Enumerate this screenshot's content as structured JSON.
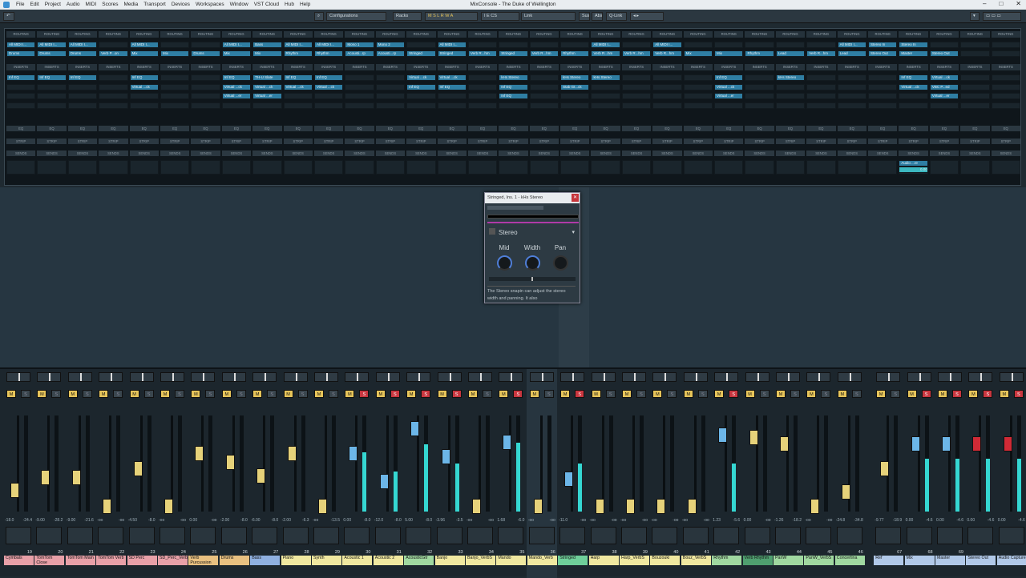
{
  "titlebar": {
    "menus": [
      "File",
      "Edit",
      "Project",
      "Audio",
      "MIDI",
      "Scores",
      "Media",
      "Transport",
      "Devices",
      "Workspaces",
      "Window",
      "VST Cloud",
      "Hub",
      "Help"
    ],
    "title": "MixConsole - The Duke of Wellington"
  },
  "toolbar": {
    "configurations": "Configurations",
    "racks": "Racks",
    "link": "Link",
    "sus": "Sus",
    "abs": "Abs",
    "qlink": "Q-Link",
    "mode_letters": "M S L R W A",
    "env": "I E CS"
  },
  "rack": {
    "routing": "ROUTING",
    "inserts": "INSERTS",
    "eq": "EQ",
    "strip": "STRIP",
    "sends": "SENDS"
  },
  "plugin": {
    "title": "Stringed, Ins. 1 - kHs Stereo",
    "module": "Stereo",
    "knobs": [
      "Mid",
      "Width",
      "Pan"
    ],
    "desc": "The Stereo snapin can adjust the stereo width and panning. It also"
  },
  "sends_slot": {
    "label": "Audio ...re",
    "value": "0.00"
  },
  "channels": [
    {
      "n": "19",
      "name": "Cymbals",
      "color": "#e8a0a8",
      "in": "All MIDI I...",
      "out": "Drums",
      "ins": [
        "Inf EQ"
      ],
      "vals": [
        "-18.0",
        "-24.4"
      ],
      "fader": 0.2,
      "meter": 0,
      "s": false
    },
    {
      "n": "20",
      "name": "TomTom Close",
      "color": "#e8a0a8",
      "in": "All MIDI I...",
      "out": "Drums",
      "ins": [
        "Inf EQ"
      ],
      "vals": [
        "-9.00",
        "-28.2"
      ],
      "fader": 0.35,
      "meter": 0,
      "s": false
    },
    {
      "n": "21",
      "name": "TomTom Main",
      "color": "#e8a0a8",
      "in": "All MIDI I...",
      "out": "Drums",
      "ins": [
        "Inf EQ"
      ],
      "vals": [
        "-9.00",
        "-21.6"
      ],
      "fader": 0.35,
      "meter": 0,
      "s": false
    },
    {
      "n": "22",
      "name": "TomTom Verb",
      "color": "#e8a0a8",
      "in": "",
      "out": "Verb P...on",
      "ins": [],
      "vals": [
        "-oo",
        "-oo"
      ],
      "fader": 0.02,
      "meter": 0,
      "s": false
    },
    {
      "n": "23",
      "name": "SD Perc",
      "color": "#e8a0a8",
      "in": "All MIDI I...",
      "out": "Mix",
      "ins": [
        "Inf EQ",
        "Virtual ...ck"
      ],
      "vals": [
        "-4.50",
        "-8.0"
      ],
      "fader": 0.45,
      "meter": 0,
      "s": false
    },
    {
      "n": "24",
      "name": "SD_Perc_Verb",
      "color": "#e8a0a8",
      "in": "",
      "out": "Mix",
      "ins": [],
      "vals": [
        "-oo",
        "-oo"
      ],
      "fader": 0.02,
      "meter": 0,
      "s": false
    },
    {
      "n": "25",
      "name": "Verb Purcussion",
      "color": "#e8c080",
      "in": "",
      "out": "Drums",
      "ins": [],
      "vals": [
        "0.00",
        "-oo"
      ],
      "fader": 0.62,
      "meter": 0,
      "s": false
    },
    {
      "n": "26",
      "name": "Drums",
      "color": "#e8c080",
      "in": "All MIDI I...",
      "out": "Mix",
      "ins": [
        "Inf EQ",
        "Virtual ...ck",
        "Virtual ...er"
      ],
      "vals": [
        "-2.00",
        "-8.0"
      ],
      "fader": 0.52,
      "meter": 0,
      "s": false
    },
    {
      "n": "27",
      "name": "Bass",
      "color": "#8fb0e0",
      "in": "Bass",
      "out": "Mix",
      "ins": [
        "TH-U Slate",
        "Virtual ...ck",
        "Virtual ...er"
      ],
      "vals": [
        "-6.00",
        "-8.0"
      ],
      "fader": 0.36,
      "meter": 0,
      "s": false
    },
    {
      "n": "28",
      "name": "Piano",
      "color": "#f0e8a0",
      "in": "All MIDI I...",
      "out": "Rhythm",
      "ins": [
        "Inf EQ",
        "Virtual ...ck"
      ],
      "vals": [
        "-2.00",
        "-6.3"
      ],
      "fader": 0.62,
      "meter": 0,
      "s": false
    },
    {
      "n": "29",
      "name": "Synth",
      "color": "#f0e8a0",
      "in": "All MIDI I...",
      "out": "Rhythm",
      "ins": [
        "Inf EQ",
        "Virtual ...ck"
      ],
      "vals": [
        "-oo",
        "-13.5"
      ],
      "fader": 0.02,
      "meter": 0,
      "s": false
    },
    {
      "n": "30",
      "name": "Acoustic 1",
      "color": "#f0e8a0",
      "in": "Mono 1",
      "out": "Acousti...rp",
      "ins": [],
      "vals": [
        "0.00",
        "-8.0"
      ],
      "fader": 0.62,
      "meter": 0.62,
      "s": true
    },
    {
      "n": "31",
      "name": "Acoustic 2",
      "color": "#f0e8a0",
      "in": "Mono 2",
      "out": "Acousti...rp",
      "ins": [],
      "vals": [
        "-12.0",
        "-8.0"
      ],
      "fader": 0.3,
      "meter": 0.42,
      "s": true
    },
    {
      "n": "32",
      "name": "AcousticGtr",
      "color": "#a0d8a0",
      "in": "",
      "out": "Stringed",
      "ins": [
        "Virtual ...ck",
        "Inf EQ"
      ],
      "vals": [
        "5.00",
        "-8.0"
      ],
      "fader": 0.9,
      "meter": 0.7,
      "s": true
    },
    {
      "n": "33",
      "name": "Banjo",
      "color": "#f0e8a0",
      "in": "All MIDI I...",
      "out": "Stringed",
      "ins": [
        "Virtual ...ck",
        "Inf EQ"
      ],
      "vals": [
        "-3.96",
        "-3.5"
      ],
      "fader": 0.58,
      "meter": 0.5,
      "s": true
    },
    {
      "n": "34",
      "name": "Banjo_VerbS",
      "color": "#f0e8a0",
      "in": "",
      "out": "Verb R...hm",
      "ins": [],
      "vals": [
        "-oo",
        "-oo"
      ],
      "fader": 0.02,
      "meter": 0,
      "s": false
    },
    {
      "n": "35",
      "name": "Mando",
      "color": "#f0e8a0",
      "in": "",
      "out": "Stringed",
      "ins": [
        "kHs Stereo",
        "Inf EQ",
        "Inf EQ"
      ],
      "vals": [
        "1.68",
        "-6.0"
      ],
      "fader": 0.75,
      "meter": 0.72,
      "s": true
    },
    {
      "n": "36",
      "name": "Mando_Verb",
      "color": "#f0e8a0",
      "in": "",
      "out": "Verb R...hm",
      "ins": [],
      "vals": [
        "-oo",
        "-oo"
      ],
      "fader": 0.02,
      "meter": 0,
      "s": false
    },
    {
      "n": "37",
      "name": "Stringed",
      "color": "#6fcf9a",
      "in": "",
      "out": "Rhythm",
      "ins": [
        "kHs Stereo",
        "Stab Gt...ck"
      ],
      "vals": [
        "-11.0",
        "-oo"
      ],
      "fader": 0.33,
      "meter": 0.5,
      "s": true
    },
    {
      "n": "38",
      "name": "Harp",
      "color": "#f0e8a0",
      "in": "All MIDI I...",
      "out": "Verb R...hm",
      "ins": [
        "kHs Stereo"
      ],
      "vals": [
        "-oo",
        "-oo"
      ],
      "fader": 0.02,
      "meter": 0,
      "s": false
    },
    {
      "n": "39",
      "name": "Harp_VerbS",
      "color": "#f0e8a0",
      "in": "",
      "out": "Verb R...hm",
      "ins": [],
      "vals": [
        "-oo",
        "-oo"
      ],
      "fader": 0.02,
      "meter": 0,
      "s": false
    },
    {
      "n": "40",
      "name": "Bouzouki",
      "color": "#f0e8a0",
      "in": "All MIDI I...",
      "out": "Verb R...hm",
      "ins": [],
      "vals": [
        "-oo",
        "-oo"
      ],
      "fader": 0.02,
      "meter": 0,
      "s": false
    },
    {
      "n": "41",
      "name": "Bouz_VerbS",
      "color": "#f0e8a0",
      "in": "",
      "out": "Mix",
      "ins": [],
      "vals": [
        "-oo",
        "-oo"
      ],
      "fader": 0.02,
      "meter": 0,
      "s": false
    },
    {
      "n": "42",
      "name": "Rhythm",
      "color": "#a0d8a0",
      "in": "",
      "out": "Mix",
      "ins": [
        "Inf EQ",
        "Virtual ...ck",
        "Virtual ...er"
      ],
      "vals": [
        "1.23",
        "-5.6"
      ],
      "fader": 0.83,
      "meter": 0.5,
      "s": true
    },
    {
      "n": "43",
      "name": "Verb Rhythm",
      "color": "#4f9f6f",
      "in": "",
      "out": "Rhythm",
      "ins": [],
      "vals": [
        "0.00",
        "-oo"
      ],
      "fader": 0.8,
      "meter": 0,
      "s": false
    },
    {
      "n": "44",
      "name": "PanW",
      "color": "#a0d8a0",
      "in": "",
      "out": "Lead",
      "ins": [
        "kHs Stereo"
      ],
      "vals": [
        "-1.26",
        "-18.2"
      ],
      "fader": 0.73,
      "meter": 0,
      "s": false
    },
    {
      "n": "45",
      "name": "PanW_VerbS",
      "color": "#a0d8a0",
      "in": "",
      "out": "Verb R...hm",
      "ins": [],
      "vals": [
        "-oo",
        "-oo"
      ],
      "fader": 0.02,
      "meter": 0,
      "s": false
    },
    {
      "n": "46",
      "name": "Concertina",
      "color": "#a0d8a0",
      "in": "All MIDI I...",
      "out": "Lead",
      "ins": [],
      "vals": [
        "-24.8",
        "-34.8"
      ],
      "fader": 0.18,
      "meter": 0,
      "s": false
    },
    {
      "n": "67",
      "name": "Ref",
      "color": "#b0c8e8",
      "in": "Stereo In",
      "out": "Stereo Out",
      "ins": [],
      "vals": [
        "-9.77",
        "-18.9"
      ],
      "fader": 0.45,
      "meter": 0,
      "s": false
    },
    {
      "n": "68",
      "name": "Mix",
      "color": "#b0c8e8",
      "in": "Stereo In",
      "out": "Master",
      "ins": [
        "Inf EQ",
        "Virtual ...ck"
      ],
      "vals": [
        "0.00",
        "-4.6"
      ],
      "fader": 0.73,
      "meter": 0.55,
      "s": true
    },
    {
      "n": "69",
      "name": "Master",
      "color": "#b0c8e8",
      "in": "",
      "out": "Stereo Out",
      "ins": [
        "Virtual ...ck",
        "VBC P...ed",
        "Virtual ...er"
      ],
      "vals": [
        "0.00",
        "-4.6"
      ],
      "fader": 0.73,
      "meter": 0.55,
      "s": true
    },
    {
      "n": "",
      "name": "Stereo Out",
      "color": "#b0c8e8",
      "in": "",
      "out": "",
      "ins": [],
      "vals": [
        "0.00",
        "-4.6"
      ],
      "fader": 0.73,
      "meter": 0.55,
      "s": true,
      "red": true
    },
    {
      "n": "",
      "name": "Audio Capture",
      "color": "#b0c8e8",
      "in": "",
      "out": "",
      "ins": [],
      "vals": [
        "0.00",
        "-4.6"
      ],
      "fader": 0.73,
      "meter": 0.55,
      "s": true,
      "red": true
    }
  ]
}
